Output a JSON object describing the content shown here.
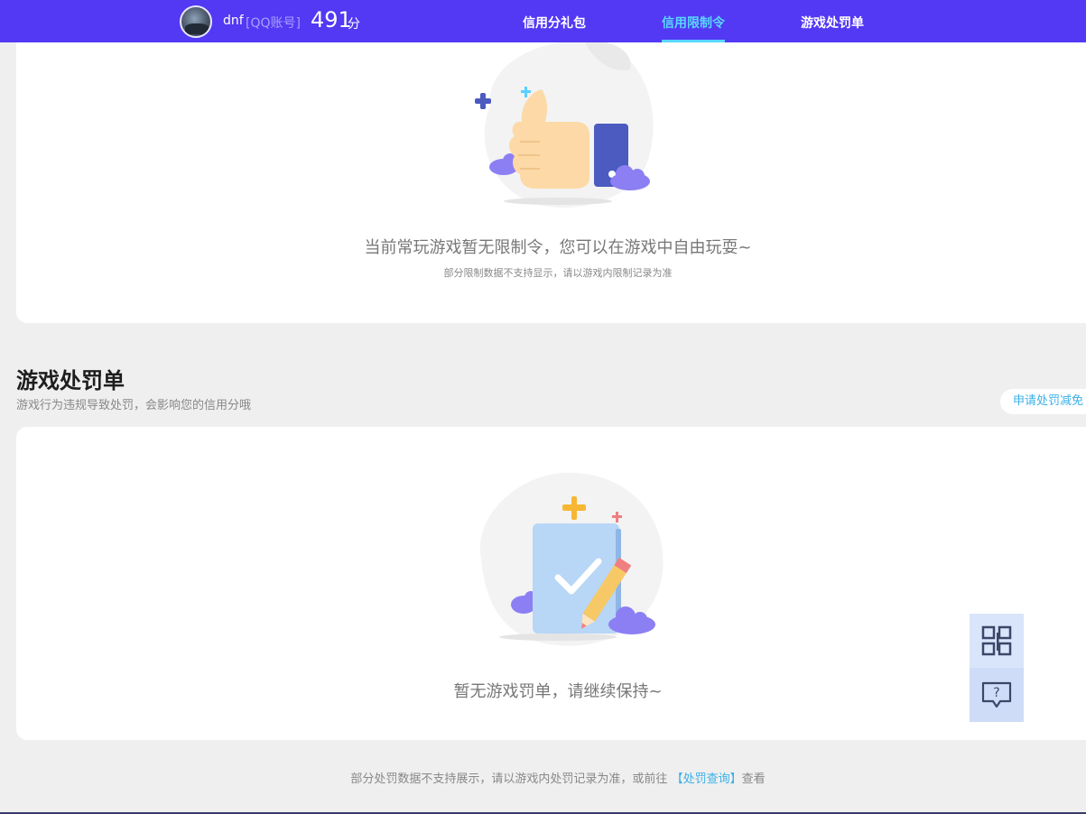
{
  "header": {
    "username": "dnf",
    "account_type": "[QQ账号]",
    "score": "491",
    "score_unit": "分",
    "tabs": [
      {
        "label": "信用分礼包",
        "active": false
      },
      {
        "label": "信用限制令",
        "active": true
      },
      {
        "label": "游戏处罚单",
        "active": false
      }
    ]
  },
  "restriction": {
    "empty_message": "当前常玩游戏暂无限制令，您可以在游戏中自由玩耍~",
    "note": "部分限制数据不支持显示，请以游戏内限制记录为准"
  },
  "penalty": {
    "title": "游戏处罚单",
    "description": "游戏行为违规导致处罚，会影响您的信用分哦",
    "appeal_button": "申请处罚减免",
    "empty_message": "暂无游戏罚单，请继续保持~"
  },
  "footer": {
    "note_prefix": "部分处罚数据不支持展示，请以游戏内处罚记录为准，或前往",
    "link_label": "【处罚查询】",
    "note_suffix": "查看"
  },
  "float_widget": {
    "qr_icon": "qr-code-icon",
    "feedback_icon": "feedback-icon"
  },
  "colors": {
    "header_bg": "#5338f4",
    "active_tab": "#59d7ff",
    "link": "#3ab0e8",
    "page_bg": "#efefef"
  }
}
